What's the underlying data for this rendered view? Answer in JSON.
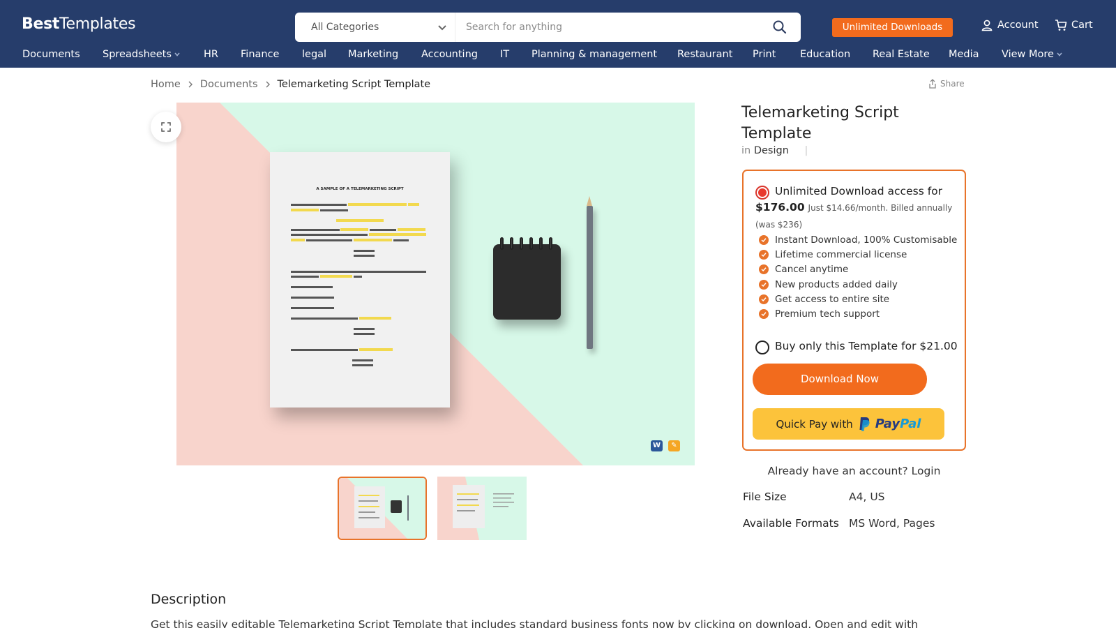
{
  "header": {
    "logo_bold": "Best",
    "logo_rest": "Templates",
    "category_select": "All Categories",
    "search_placeholder": "Search for anything",
    "unlimited_button": "Unlimited Downloads",
    "account_label": "Account",
    "cart_label": "Cart",
    "bg_color": "#263d6b",
    "accent_color": "#f26b1d"
  },
  "nav": {
    "items": [
      {
        "label": "Documents",
        "dropdown": false
      },
      {
        "label": "Spreadsheets",
        "dropdown": true
      },
      {
        "label": "HR",
        "dropdown": false
      },
      {
        "label": "Finance",
        "dropdown": false
      },
      {
        "label": "legal",
        "dropdown": false
      },
      {
        "label": "Marketing",
        "dropdown": false
      },
      {
        "label": "Accounting",
        "dropdown": false
      },
      {
        "label": "IT",
        "dropdown": false
      },
      {
        "label": "Planning & management",
        "dropdown": false
      },
      {
        "label": "Restaurant",
        "dropdown": false
      },
      {
        "label": "Print",
        "dropdown": false
      },
      {
        "label": "Education",
        "dropdown": false
      },
      {
        "label": "Real Estate",
        "dropdown": false
      },
      {
        "label": "Media",
        "dropdown": false
      },
      {
        "label": "View More",
        "dropdown": true
      }
    ]
  },
  "breadcrumb": {
    "home": "Home",
    "section": "Documents",
    "current": "Telemarketing Script Template",
    "share": "Share"
  },
  "preview": {
    "doc_title": "A SAMPLE OF A TELEMARKETING SCRIPT",
    "formats": [
      {
        "name": "word-icon",
        "glyph": "W",
        "color": "#2b579a"
      },
      {
        "name": "pages-icon",
        "glyph": "✎",
        "color": "#f5a623"
      }
    ]
  },
  "product": {
    "title": "Telemarketing Script Template",
    "category_prefix": "in",
    "category": "Design",
    "category_divider": "|"
  },
  "plans": {
    "unlimited_text": "Unlimited Download access for",
    "unlimited_price": "$176.00",
    "unlimited_sub": "Just $14.66/month. Billed annually (was $236)",
    "features": [
      "Instant Download, 100% Customisable",
      "Lifetime commercial license",
      "Cancel anytime",
      "New products added daily",
      "Get access to entire site",
      "Premium tech support"
    ],
    "single_text": "Buy only this Template for $21.00",
    "download_button": "Download Now",
    "paypal_prefix": "Quick Pay with",
    "paypal_logo_a": "Pay",
    "paypal_logo_b": "Pal"
  },
  "account": {
    "prompt": "Already have an account?",
    "login": "Login"
  },
  "specs": [
    {
      "key": "File Size",
      "value": "A4, US"
    },
    {
      "key": "Available Formats",
      "value": "MS Word, Pages"
    }
  ],
  "description": {
    "heading": "Description",
    "text": "Get this easily editable Telemarketing Script Template that includes standard business fonts now by clicking on download. Open and edit with"
  }
}
